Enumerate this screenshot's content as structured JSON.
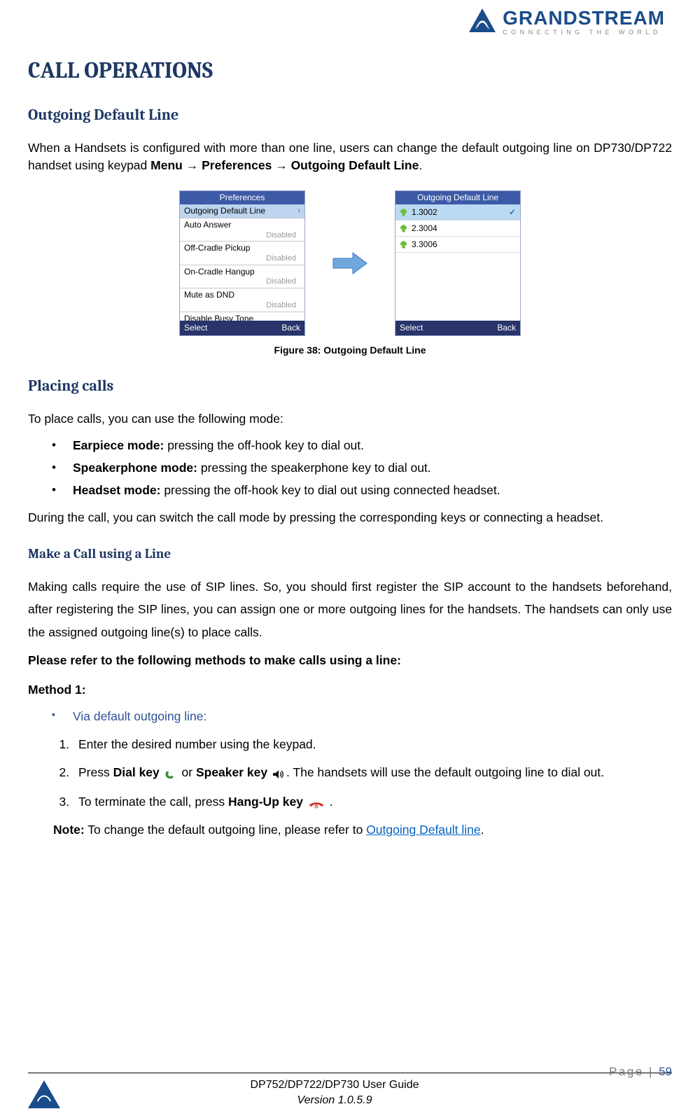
{
  "logo": {
    "brand": "GRANDSTREAM",
    "tagline": "CONNECTING THE WORLD"
  },
  "h1": "CALL OPERATIONS",
  "sec1": {
    "title": "Outgoing Default Line",
    "para_a": "When a Handsets is configured with more than one line, users can change the default outgoing line on DP730/DP722 handset using keypad ",
    "menu": "Menu",
    "pref": "Preferences",
    "odl": "Outgoing Default Line",
    "para_end": "."
  },
  "shot_left": {
    "title": "Preferences",
    "rows": [
      {
        "label": "Outgoing Default Line",
        "sub": "",
        "chev": true,
        "sel": true
      },
      {
        "label": "Auto Answer",
        "sub": "Disabled"
      },
      {
        "label": "Off-Cradle Pickup",
        "sub": "Disabled"
      },
      {
        "label": "On-Cradle Hangup",
        "sub": "Disabled"
      },
      {
        "label": "Mute as DND",
        "sub": "Disabled"
      },
      {
        "label": "Disable Busy Tone",
        "sub": "",
        "cut": true
      }
    ],
    "soft_left": "Select",
    "soft_right": "Back"
  },
  "shot_right": {
    "title": "Outgoing Default Line",
    "rows": [
      {
        "label": "1.3002",
        "sel": true,
        "check": true
      },
      {
        "label": "2.3004"
      },
      {
        "label": "3.3006"
      }
    ],
    "soft_left": "Select",
    "soft_right": "Back"
  },
  "fig_caption": "Figure 38: Outgoing Default Line",
  "sec2": {
    "title": "Placing calls",
    "intro": "To place calls, you can use the following mode:",
    "bullets": [
      {
        "b": "Earpiece mode:",
        "t": " pressing the off-hook key to dial out."
      },
      {
        "b": "Speakerphone mode:",
        "t": " pressing the speakerphone key to dial out."
      },
      {
        "b": "Headset mode:",
        "t": " pressing the off-hook key to dial out using connected headset."
      }
    ],
    "outro": "During the call, you can switch the call mode by pressing the corresponding keys or connecting a headset."
  },
  "sec3": {
    "title": "Make a Call using a Line",
    "para": "Making calls require the use of SIP lines. So, you should first register the SIP account to the handsets beforehand, after registering the SIP lines, you can assign one or more outgoing lines for the handsets. The handsets can only use the assigned outgoing line(s) to place calls.",
    "ref": "Please refer to the following methods to make calls using a line:",
    "method1": "Method 1:",
    "via": "Via default outgoing line:",
    "step1": "Enter the desired number using the keypad.",
    "step2_a": "Press ",
    "step2_dial": "Dial key",
    "step2_or": " or ",
    "step2_spk": "Speaker key",
    "step2_b": ". The handsets will use the default outgoing line to dial out.",
    "step3_a": "To terminate the call, press ",
    "step3_hang": "Hang-Up key",
    "step3_b": " .",
    "note_a": "Note:",
    "note_b": " To change the default outgoing line, please refer to ",
    "note_link": "Outgoing Default line",
    "note_c": "."
  },
  "footer": {
    "guide": "DP752/DP722/DP730 User Guide",
    "version": "Version 1.0.5.9",
    "page_label": "Page | ",
    "page_num": "59"
  }
}
